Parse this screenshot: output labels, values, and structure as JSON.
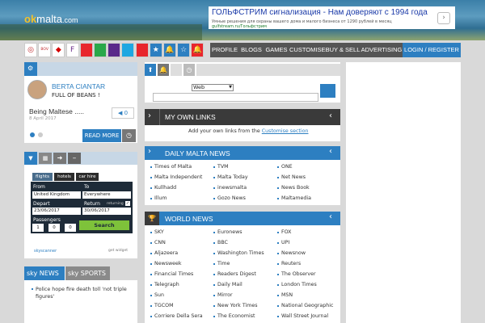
{
  "brand": {
    "prefix": "ok",
    "name": "malta",
    "suffix": ".com"
  },
  "ad": {
    "headline": "ГОЛЬФСТРИМ сигнализация - Нам доверяют с 1994 года",
    "body": "Умные решения для охраны вашего дома и малого бизнеса от 1290 рублей в месяц",
    "url": "gulfstream.ru/Гольфстрим",
    "next": "›"
  },
  "iconbar": [
    {
      "icon": "eye-icon",
      "glyph": "◎",
      "color": "#ffffff",
      "fg": "#c0282d"
    },
    {
      "icon": "bov-icon",
      "glyph": "BOV",
      "color": "#ffffff",
      "fg": "#c0282d"
    },
    {
      "icon": "hsbc-icon",
      "glyph": "◆",
      "color": "#ffffff",
      "fg": "#d40000"
    },
    {
      "icon": "flag-icon",
      "glyph": "F",
      "color": "#ffffff",
      "fg": "#6a2a8a"
    },
    {
      "icon": "red-app-icon",
      "glyph": "",
      "color": "#e8262c",
      "fg": "#ffffff"
    },
    {
      "icon": "green-app-icon",
      "glyph": "",
      "color": "#2aa84a",
      "fg": "#ffffff"
    },
    {
      "icon": "purple-app-icon",
      "glyph": "",
      "color": "#5a2a8a",
      "fg": "#ffffff"
    },
    {
      "icon": "skype-icon",
      "glyph": "",
      "color": "#1ea7e1",
      "fg": "#ffffff"
    },
    {
      "icon": "chat-icon",
      "glyph": "",
      "color": "#e8262c",
      "fg": "#ffffff"
    },
    {
      "icon": "star-icon",
      "glyph": "★",
      "color": "#2d7fc1",
      "fg": "#ffffff"
    },
    {
      "icon": "bell-icon",
      "glyph": "🔔",
      "color": "#2d7fc1",
      "fg": "#ffffff"
    },
    {
      "icon": "star-outline-icon",
      "glyph": "☆",
      "color": "#2d7fc1",
      "fg": "#ffffff"
    },
    {
      "icon": "alarm-icon",
      "glyph": "🔔",
      "color": "#e8262c",
      "fg": "#ffffff"
    }
  ],
  "nav": [
    "PROFILE",
    "BLOGS",
    "GAMES",
    "CUSTOMISE",
    "BUY & SELL",
    "ADVERTISING",
    "LOGIN / REGISTER"
  ],
  "profile": {
    "name": "BERTA CIANTAR",
    "status": "FULL OF BEANS !",
    "post": "Being Maltese .....",
    "date": "8 April 2017",
    "likes": "0",
    "read_more": "READ MORE"
  },
  "search": {
    "engine": "Web"
  },
  "own_links": {
    "title": "MY OWN LINKS",
    "prompt": "Add your own links from the",
    "link": "Customise section"
  },
  "flights": {
    "tabs": [
      "flights",
      "hotels",
      "car hire"
    ],
    "from_label": "From",
    "from_value": "United Kingdom",
    "to_label": "To",
    "to_value": "Everywhere",
    "depart_label": "Depart",
    "depart_value": "23/06/2017",
    "return_label": "Return",
    "return_value": "30/06/2017",
    "returning": "returning",
    "passengers_label": "Passengers",
    "adults": "1",
    "children": "0",
    "infants": "0",
    "search": "Search",
    "brand": "skyscanner",
    "widget": "get widget"
  },
  "sky": {
    "tab1": "sky NEWS",
    "tab2": "sky SPORTS",
    "headline": "Police hope fire death toll 'not triple figures'"
  },
  "daily": {
    "title": "DAILY MALTA NEWS",
    "cols": [
      [
        "Times of Malta",
        "Malta Independent",
        "Kullhadd",
        "Illum"
      ],
      [
        "TVM",
        "Malta Today",
        "inewsmalta",
        "Gozo News"
      ],
      [
        "ONE",
        "Net News",
        "News Book",
        "Maltamedia"
      ]
    ]
  },
  "world": {
    "title": "WORLD NEWS",
    "cols": [
      [
        "SKY",
        "CNN",
        "Aljazeera",
        "Newsweek",
        "Financial Times",
        "Telegraph",
        "Sun",
        "TGCOM",
        "Corriere Della Sera"
      ],
      [
        "Euronews",
        "BBC",
        "Washington Times",
        "Time",
        "Readers Digest",
        "Daily Mail",
        "Mirror",
        "New York Times",
        "The Economist"
      ],
      [
        "FOX",
        "UPI",
        "Newsnow",
        "Reuters",
        "The Observer",
        "London Times",
        "MSN",
        "National Geographic",
        "Wall Street Journal"
      ]
    ]
  }
}
